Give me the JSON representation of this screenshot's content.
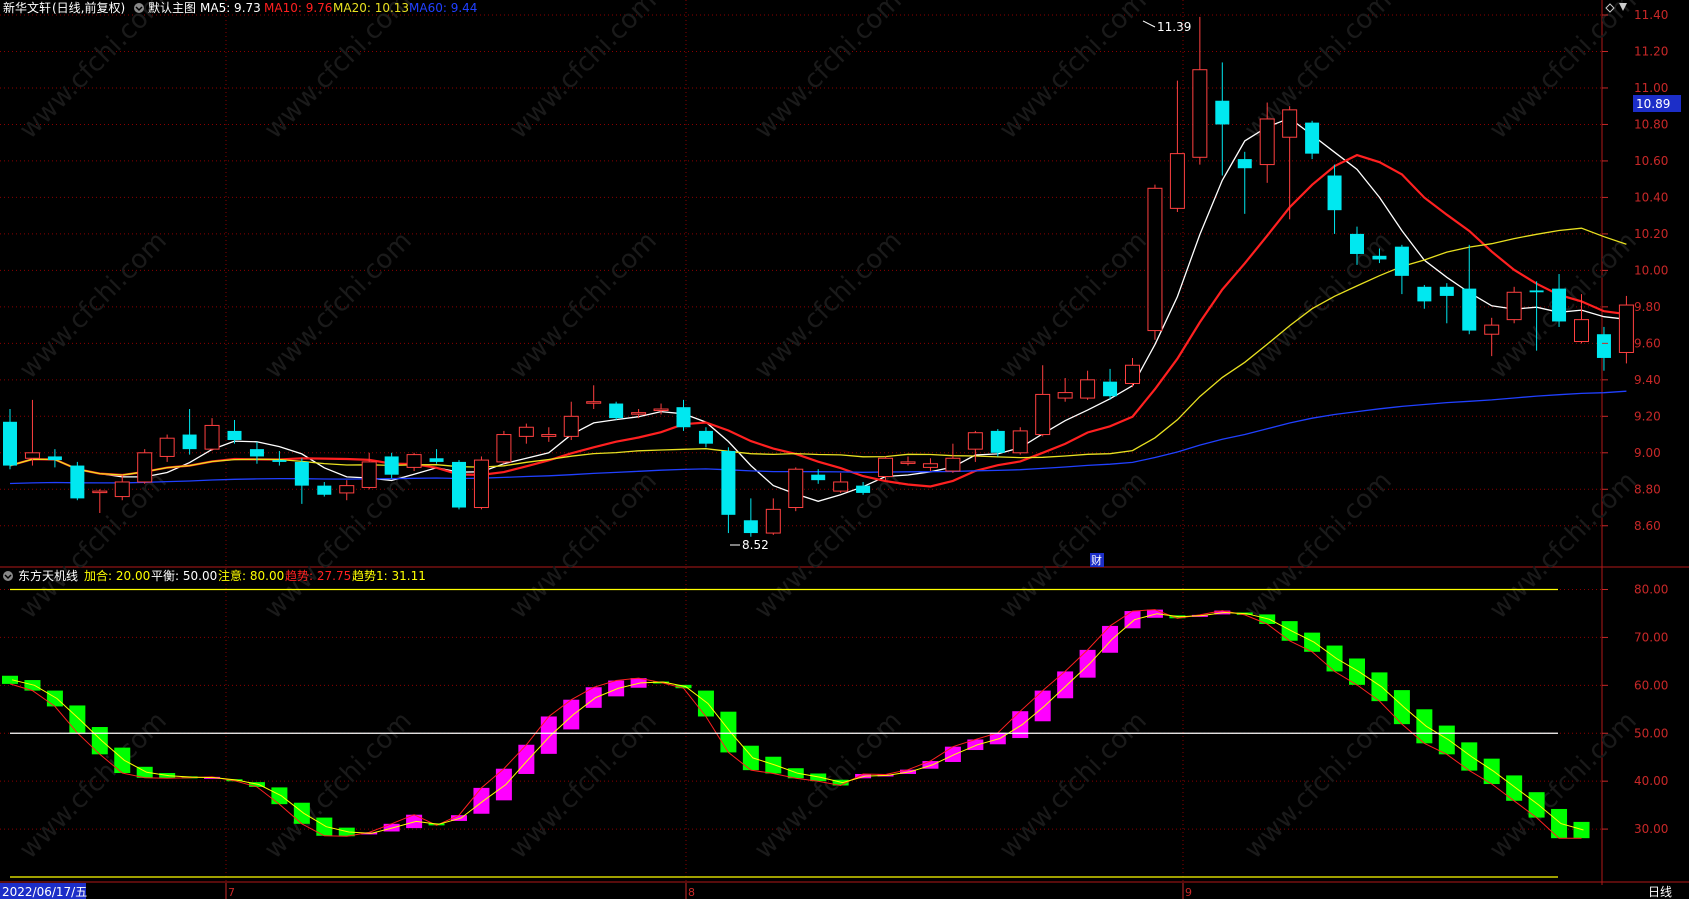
{
  "main_panel": {
    "stock_name": "新华文轩",
    "period": "(日线,前复权)",
    "indicator_name": "默认主图",
    "ma_legend": [
      {
        "label": "MA5: 9.73",
        "color": "#ffffff"
      },
      {
        "label": "MA10: 9.76",
        "color": "#ff2020"
      },
      {
        "label": "MA20: 10.13",
        "color": "#e8e020"
      },
      {
        "label": "MA60: 9.44",
        "color": "#2040ff"
      }
    ],
    "price_axis_labels": [
      "11.40",
      "11.20",
      "11.00",
      "10.80",
      "10.60",
      "10.40",
      "10.20",
      "10.00",
      "9.80",
      "9.60",
      "9.40",
      "9.20",
      "9.00",
      "8.80",
      "8.60"
    ],
    "current_price_tag": "10.89",
    "high_marker": "11.39",
    "low_marker": "8.52",
    "finance_marker": "财",
    "watermark": "www.cfchi.com"
  },
  "sub_panel": {
    "indicator_name": "东方天机线",
    "legend": [
      {
        "label": "加合: 20.00",
        "color": "#ffff00"
      },
      {
        "label": "平衡: 50.00",
        "color": "#ffffff"
      },
      {
        "label": "注意: 80.00",
        "color": "#ffff00"
      },
      {
        "label": "趋势: 27.75",
        "color": "#ff2020"
      },
      {
        "label": "趋势1: 31.11",
        "color": "#ffff00"
      }
    ],
    "axis_labels": [
      "80.00",
      "70.00",
      "60.00",
      "50.00",
      "40.00",
      "30.00"
    ]
  },
  "date_axis": {
    "start_date": "2022/06/17/五",
    "month_labels": [
      "7",
      "8",
      "9"
    ],
    "period_button": "日线"
  },
  "colors": {
    "up": "#ff4040",
    "down": "#00e8f0",
    "indicator_up": "#ff00ff",
    "indicator_down": "#00ff00",
    "grid": "#8b0000",
    "axis_text": "#c82828"
  },
  "chart_data": [
    {
      "type": "candlestick",
      "title": "新华文轩 (日线,前复权)",
      "ylim": [
        8.5,
        11.4
      ],
      "candles": [
        {
          "o": 9.17,
          "c": 8.93,
          "h": 9.24,
          "l": 8.91
        },
        {
          "o": 8.97,
          "c": 9.0,
          "h": 9.29,
          "l": 8.93
        },
        {
          "o": 8.98,
          "c": 8.96,
          "h": 9.02,
          "l": 8.92
        },
        {
          "o": 8.93,
          "c": 8.75,
          "h": 8.95,
          "l": 8.74
        },
        {
          "o": 8.79,
          "c": 8.79,
          "h": 8.8,
          "l": 8.67
        },
        {
          "o": 8.76,
          "c": 8.84,
          "h": 8.88,
          "l": 8.74
        },
        {
          "o": 8.84,
          "c": 9.0,
          "h": 9.02,
          "l": 8.83
        },
        {
          "o": 8.98,
          "c": 9.08,
          "h": 9.1,
          "l": 8.95
        },
        {
          "o": 9.1,
          "c": 9.02,
          "h": 9.24,
          "l": 8.99
        },
        {
          "o": 9.02,
          "c": 9.15,
          "h": 9.19,
          "l": 9.01
        },
        {
          "o": 9.12,
          "c": 9.07,
          "h": 9.18,
          "l": 9.05
        },
        {
          "o": 9.02,
          "c": 8.98,
          "h": 9.06,
          "l": 8.94
        },
        {
          "o": 8.96,
          "c": 8.95,
          "h": 9.01,
          "l": 8.93
        },
        {
          "o": 8.95,
          "c": 8.82,
          "h": 8.97,
          "l": 8.72
        },
        {
          "o": 8.82,
          "c": 8.77,
          "h": 8.84,
          "l": 8.76
        },
        {
          "o": 8.78,
          "c": 8.82,
          "h": 8.85,
          "l": 8.74
        },
        {
          "o": 8.81,
          "c": 8.95,
          "h": 9.0,
          "l": 8.8
        },
        {
          "o": 8.98,
          "c": 8.88,
          "h": 9.0,
          "l": 8.86
        },
        {
          "o": 8.92,
          "c": 8.99,
          "h": 9.0,
          "l": 8.9
        },
        {
          "o": 8.97,
          "c": 8.95,
          "h": 9.02,
          "l": 8.94
        },
        {
          "o": 8.95,
          "c": 8.7,
          "h": 8.96,
          "l": 8.69
        },
        {
          "o": 8.7,
          "c": 8.96,
          "h": 8.98,
          "l": 8.69
        },
        {
          "o": 8.95,
          "c": 9.1,
          "h": 9.12,
          "l": 8.94
        },
        {
          "o": 9.09,
          "c": 9.14,
          "h": 9.16,
          "l": 9.05
        },
        {
          "o": 9.09,
          "c": 9.1,
          "h": 9.14,
          "l": 9.06
        },
        {
          "o": 9.09,
          "c": 9.2,
          "h": 9.28,
          "l": 9.07
        },
        {
          "o": 9.28,
          "c": 9.28,
          "h": 9.37,
          "l": 9.24
        },
        {
          "o": 9.27,
          "c": 9.19,
          "h": 9.28,
          "l": 9.18
        },
        {
          "o": 9.22,
          "c": 9.22,
          "h": 9.24,
          "l": 9.19
        },
        {
          "o": 9.24,
          "c": 9.24,
          "h": 9.27,
          "l": 9.21
        },
        {
          "o": 9.25,
          "c": 9.14,
          "h": 9.29,
          "l": 9.12
        },
        {
          "o": 9.12,
          "c": 9.05,
          "h": 9.14,
          "l": 9.03
        },
        {
          "o": 9.01,
          "c": 8.66,
          "h": 9.03,
          "l": 8.56
        },
        {
          "o": 8.63,
          "c": 8.56,
          "h": 8.75,
          "l": 8.54
        },
        {
          "o": 8.56,
          "c": 8.69,
          "h": 8.75,
          "l": 8.55
        },
        {
          "o": 8.7,
          "c": 8.91,
          "h": 8.92,
          "l": 8.68
        },
        {
          "o": 8.88,
          "c": 8.85,
          "h": 8.91,
          "l": 8.83
        },
        {
          "o": 8.79,
          "c": 8.84,
          "h": 8.89,
          "l": 8.78
        },
        {
          "o": 8.82,
          "c": 8.78,
          "h": 8.84,
          "l": 8.77
        },
        {
          "o": 8.87,
          "c": 8.97,
          "h": 8.98,
          "l": 8.85
        },
        {
          "o": 8.95,
          "c": 8.95,
          "h": 8.98,
          "l": 8.93
        },
        {
          "o": 8.92,
          "c": 8.94,
          "h": 8.97,
          "l": 8.9
        },
        {
          "o": 8.9,
          "c": 8.97,
          "h": 9.05,
          "l": 8.89
        },
        {
          "o": 9.02,
          "c": 9.11,
          "h": 9.12,
          "l": 8.95
        },
        {
          "o": 9.12,
          "c": 9.0,
          "h": 9.13,
          "l": 8.98
        },
        {
          "o": 9.0,
          "c": 9.12,
          "h": 9.14,
          "l": 8.99
        },
        {
          "o": 9.1,
          "c": 9.32,
          "h": 9.48,
          "l": 9.09
        },
        {
          "o": 9.3,
          "c": 9.33,
          "h": 9.41,
          "l": 9.28
        },
        {
          "o": 9.3,
          "c": 9.4,
          "h": 9.45,
          "l": 9.29
        },
        {
          "o": 9.39,
          "c": 9.31,
          "h": 9.46,
          "l": 9.29
        },
        {
          "o": 9.38,
          "c": 9.48,
          "h": 9.52,
          "l": 9.36
        },
        {
          "o": 9.67,
          "c": 10.45,
          "h": 10.47,
          "l": 9.62
        },
        {
          "o": 10.34,
          "c": 10.64,
          "h": 11.04,
          "l": 10.32
        },
        {
          "o": 10.62,
          "c": 11.1,
          "h": 11.39,
          "l": 10.58
        },
        {
          "o": 10.93,
          "c": 10.8,
          "h": 11.14,
          "l": 10.52
        },
        {
          "o": 10.61,
          "c": 10.56,
          "h": 10.65,
          "l": 10.31
        },
        {
          "o": 10.58,
          "c": 10.83,
          "h": 10.92,
          "l": 10.48
        },
        {
          "o": 10.73,
          "c": 10.88,
          "h": 10.9,
          "l": 10.28
        },
        {
          "o": 10.81,
          "c": 10.64,
          "h": 10.82,
          "l": 10.61
        },
        {
          "o": 10.52,
          "c": 10.33,
          "h": 10.58,
          "l": 10.2
        },
        {
          "o": 10.2,
          "c": 10.09,
          "h": 10.24,
          "l": 10.03
        },
        {
          "o": 10.08,
          "c": 10.06,
          "h": 10.12,
          "l": 10.04
        },
        {
          "o": 10.13,
          "c": 9.97,
          "h": 10.14,
          "l": 9.87
        },
        {
          "o": 9.91,
          "c": 9.83,
          "h": 9.92,
          "l": 9.79
        },
        {
          "o": 9.91,
          "c": 9.86,
          "h": 9.93,
          "l": 9.71
        },
        {
          "o": 9.9,
          "c": 9.67,
          "h": 10.14,
          "l": 9.65
        },
        {
          "o": 9.65,
          "c": 9.7,
          "h": 9.74,
          "l": 9.53
        },
        {
          "o": 9.73,
          "c": 9.88,
          "h": 9.91,
          "l": 9.71
        },
        {
          "o": 9.89,
          "c": 9.88,
          "h": 9.94,
          "l": 9.56
        },
        {
          "o": 9.9,
          "c": 9.72,
          "h": 9.98,
          "l": 9.69
        },
        {
          "o": 9.61,
          "c": 9.73,
          "h": 9.87,
          "l": 9.6
        },
        {
          "o": 9.65,
          "c": 9.52,
          "h": 9.69,
          "l": 9.45
        },
        {
          "o": 9.55,
          "c": 9.81,
          "h": 9.86,
          "l": 9.49
        }
      ],
      "annotations": [
        "11.39",
        "8.52",
        "10.89",
        "财"
      ]
    },
    {
      "type": "bar",
      "title": "东方天机线",
      "ylim": [
        18,
        83
      ],
      "reference_lines": [
        20,
        50,
        80
      ],
      "bars": [
        {
          "o": 62.0,
          "c": 60.3
        },
        {
          "o": 61.1,
          "c": 58.9
        },
        {
          "o": 58.9,
          "c": 55.6
        },
        {
          "o": 55.8,
          "c": 50.1
        },
        {
          "o": 51.3,
          "c": 45.6
        },
        {
          "o": 47.0,
          "c": 41.7
        },
        {
          "o": 43.0,
          "c": 40.7
        },
        {
          "o": 41.7,
          "c": 40.6
        },
        {
          "o": 41.0,
          "c": 40.7
        },
        {
          "o": 40.6,
          "c": 40.9
        },
        {
          "o": 40.4,
          "c": 40.1
        },
        {
          "o": 39.8,
          "c": 38.8
        },
        {
          "o": 38.7,
          "c": 35.2
        },
        {
          "o": 35.5,
          "c": 31.1
        },
        {
          "o": 32.4,
          "c": 28.6
        },
        {
          "o": 30.3,
          "c": 28.5
        },
        {
          "o": 28.9,
          "c": 29.3
        },
        {
          "o": 29.5,
          "c": 31.1
        },
        {
          "o": 30.2,
          "c": 33.0
        },
        {
          "o": 31.2,
          "c": 30.8
        },
        {
          "o": 31.7,
          "c": 32.9
        },
        {
          "o": 33.2,
          "c": 38.6
        },
        {
          "o": 36.0,
          "c": 42.6
        },
        {
          "o": 41.5,
          "c": 47.6
        },
        {
          "o": 45.7,
          "c": 53.5
        },
        {
          "o": 50.8,
          "c": 57.0
        },
        {
          "o": 55.3,
          "c": 59.6
        },
        {
          "o": 57.7,
          "c": 61.0
        },
        {
          "o": 59.5,
          "c": 61.5
        },
        {
          "o": 60.8,
          "c": 60.6
        },
        {
          "o": 60.1,
          "c": 59.4
        },
        {
          "o": 58.9,
          "c": 53.5
        },
        {
          "o": 54.5,
          "c": 46.0
        },
        {
          "o": 47.4,
          "c": 42.3
        },
        {
          "o": 45.1,
          "c": 41.6
        },
        {
          "o": 42.7,
          "c": 40.6
        },
        {
          "o": 41.6,
          "c": 40.0
        },
        {
          "o": 40.3,
          "c": 39.1
        },
        {
          "o": 40.6,
          "c": 41.5
        },
        {
          "o": 41.0,
          "c": 41.4
        },
        {
          "o": 41.5,
          "c": 42.4
        },
        {
          "o": 42.6,
          "c": 44.2
        },
        {
          "o": 44.0,
          "c": 47.2
        },
        {
          "o": 46.5,
          "c": 48.7
        },
        {
          "o": 47.7,
          "c": 50.1
        },
        {
          "o": 49.0,
          "c": 54.6
        },
        {
          "o": 52.5,
          "c": 58.9
        },
        {
          "o": 57.3,
          "c": 62.9
        },
        {
          "o": 61.6,
          "c": 67.4
        },
        {
          "o": 66.8,
          "c": 72.4
        },
        {
          "o": 71.9,
          "c": 75.5
        },
        {
          "o": 74.1,
          "c": 75.8
        },
        {
          "o": 74.6,
          "c": 74.0
        },
        {
          "o": 74.4,
          "c": 74.7
        },
        {
          "o": 74.8,
          "c": 75.6
        },
        {
          "o": 75.2,
          "c": 74.7
        },
        {
          "o": 74.8,
          "c": 72.8
        },
        {
          "o": 73.4,
          "c": 69.3
        },
        {
          "o": 71.0,
          "c": 67.0
        },
        {
          "o": 68.3,
          "c": 62.9
        },
        {
          "o": 65.6,
          "c": 60.1
        },
        {
          "o": 62.7,
          "c": 56.7
        },
        {
          "o": 59.0,
          "c": 51.9
        },
        {
          "o": 55.0,
          "c": 47.9
        },
        {
          "o": 51.6,
          "c": 45.6
        },
        {
          "o": 48.1,
          "c": 42.2
        },
        {
          "o": 44.7,
          "c": 39.4
        },
        {
          "o": 41.2,
          "c": 35.9
        },
        {
          "o": 37.7,
          "c": 32.4
        },
        {
          "o": 34.2,
          "c": 28.1
        },
        {
          "o": 31.5,
          "c": 28.1
        }
      ]
    }
  ]
}
